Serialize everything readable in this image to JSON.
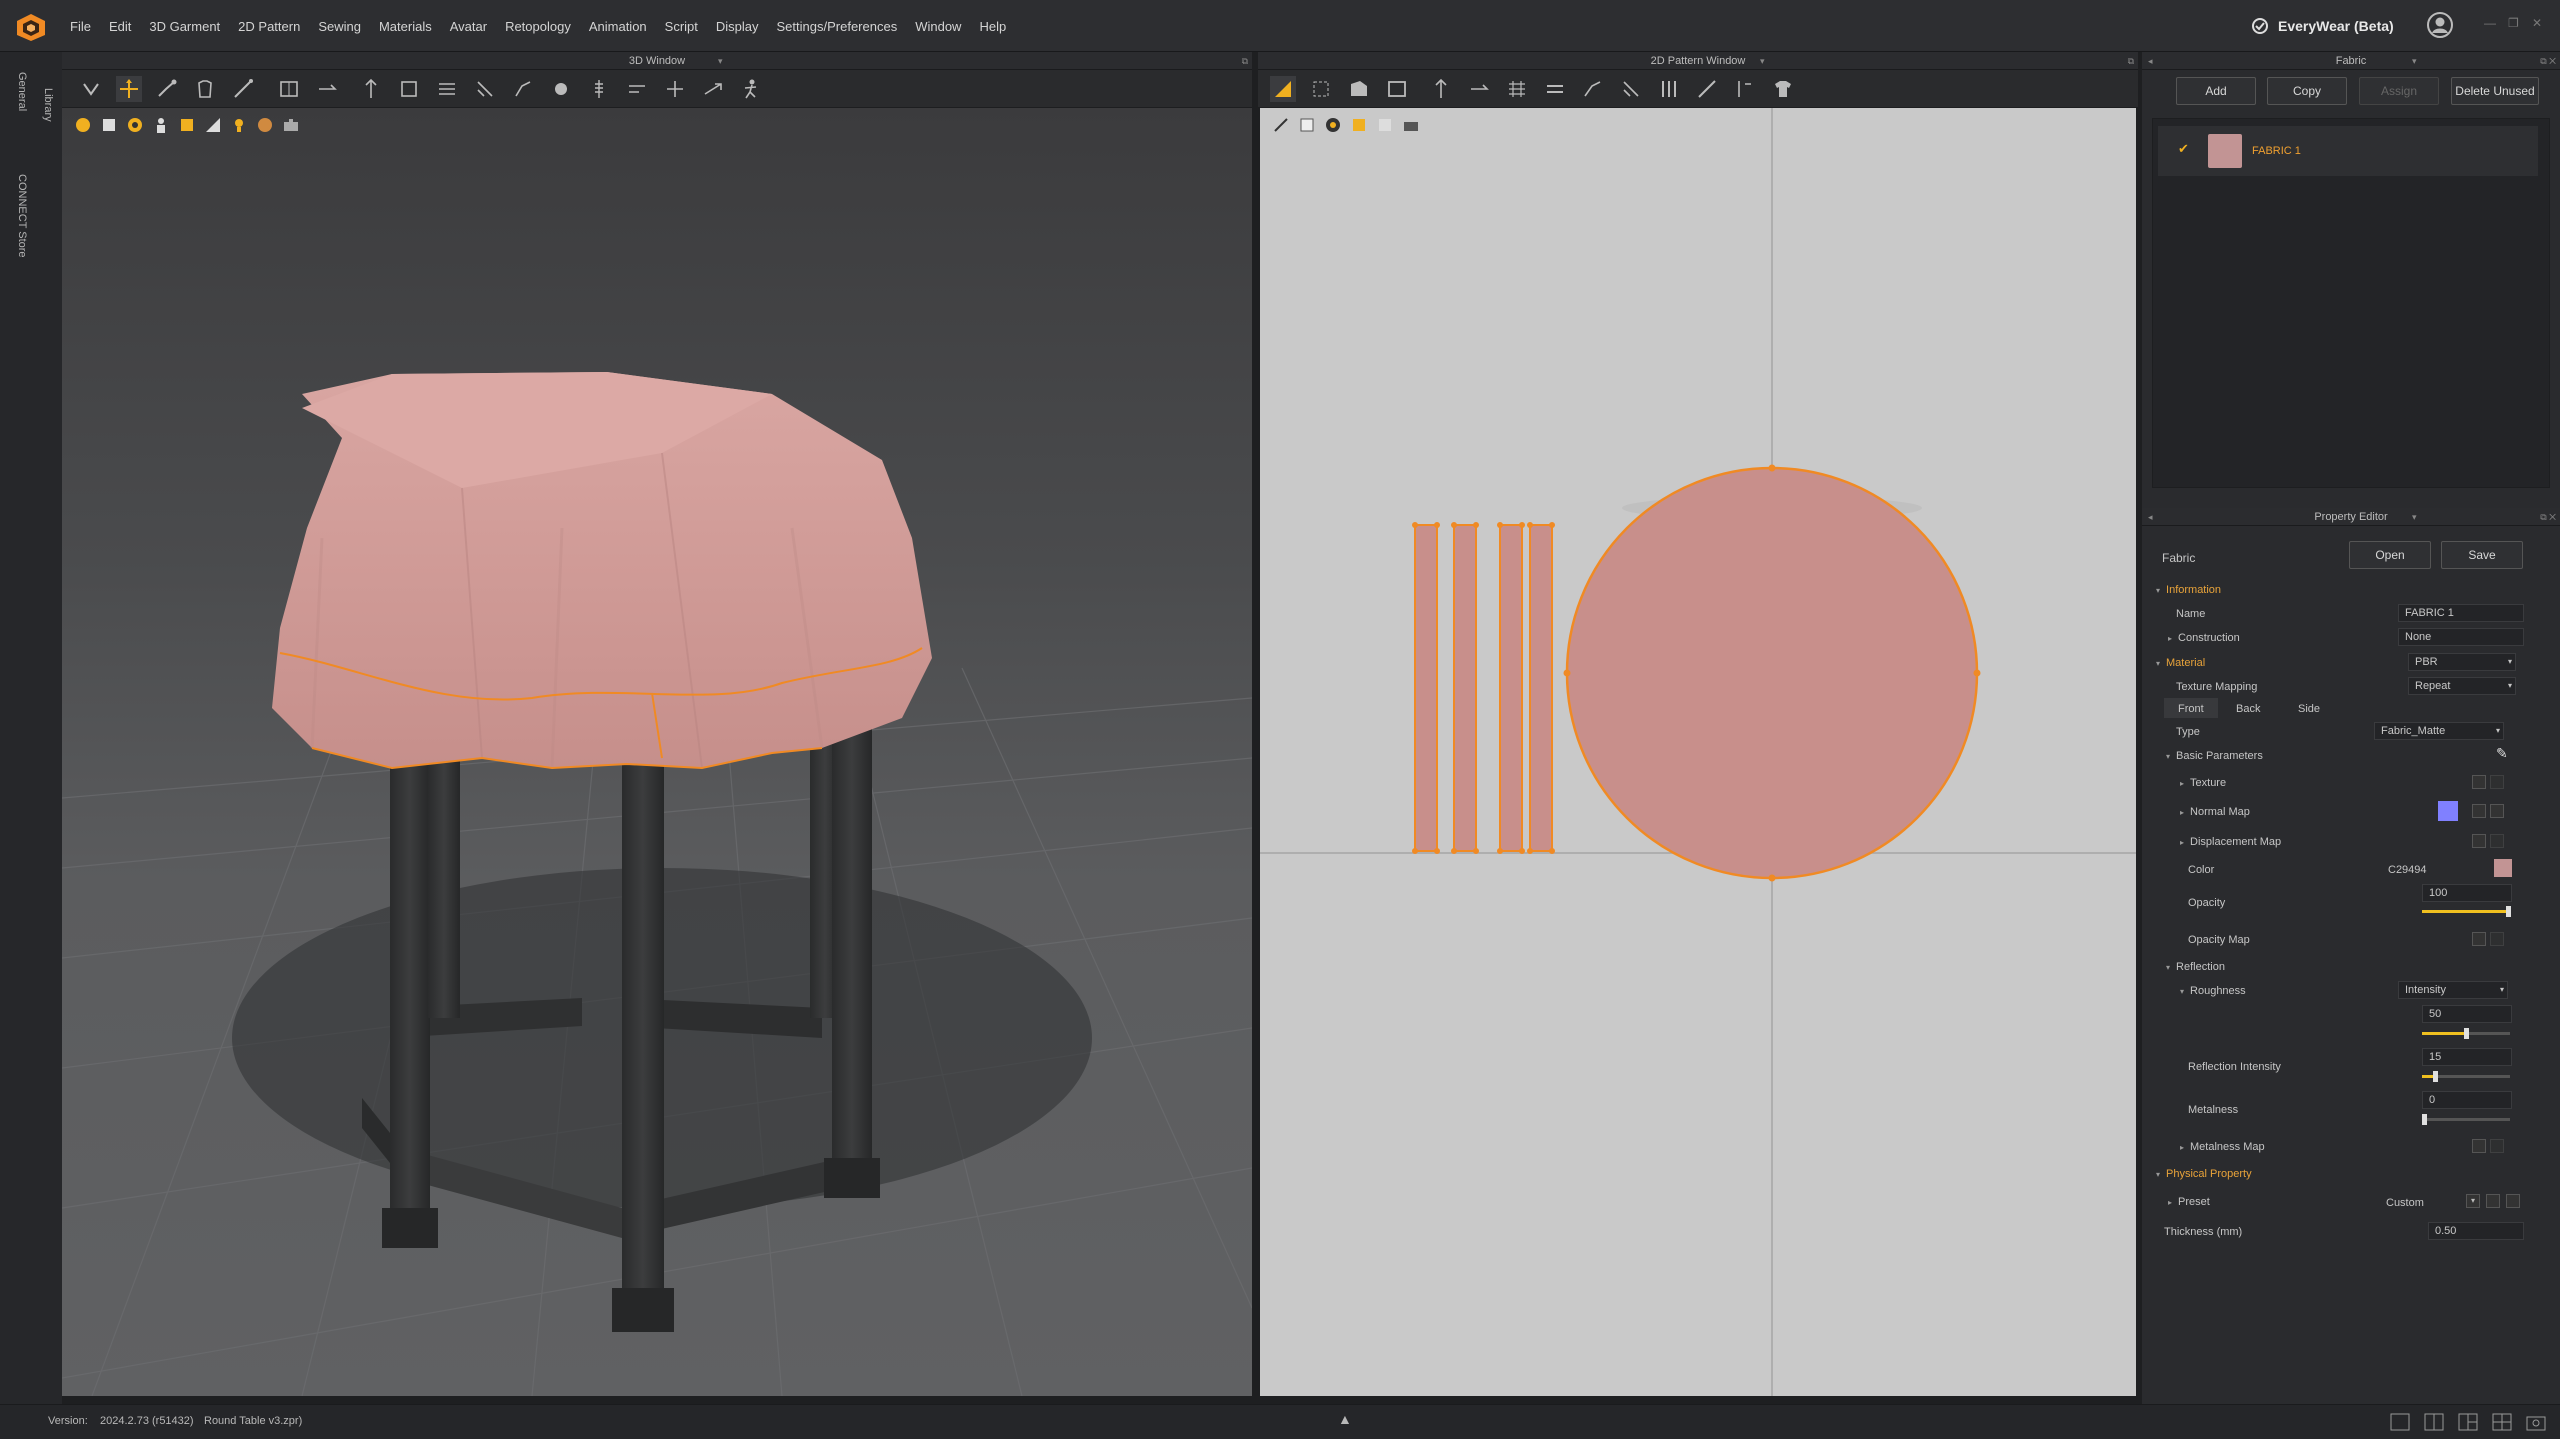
{
  "app": {
    "menu": [
      "File",
      "Edit",
      "3D Garment",
      "2D Pattern",
      "Sewing",
      "Materials",
      "Avatar",
      "Retopology",
      "Animation",
      "Script",
      "Display",
      "Settings/Preferences",
      "Window",
      "Help"
    ],
    "brand": "EveryWear (Beta)",
    "accent_color": "#f08a24"
  },
  "sidebar": {
    "tabs": [
      "General",
      "Library",
      "CONNECT Store"
    ]
  },
  "panels": {
    "window3d_title": "3D Window",
    "window2d_title": "2D Pattern Window",
    "fabric_title": "Fabric",
    "property_title": "Property Editor"
  },
  "fabric_panel": {
    "add": "Add",
    "copy": "Copy",
    "assign": "Assign",
    "delete_unused": "Delete Unused",
    "items": [
      {
        "name": "FABRIC 1",
        "swatch": "#c29494",
        "checked": true
      }
    ]
  },
  "property_editor": {
    "header": "Fabric",
    "open": "Open",
    "save": "Save",
    "information": "Information",
    "name_label": "Name",
    "name_value": "FABRIC 1",
    "construction_label": "Construction",
    "construction_value": "None",
    "material": "Material",
    "material_value": "PBR",
    "texture_mapping_label": "Texture Mapping",
    "texture_mapping_value": "Repeat",
    "sides": [
      "Front",
      "Back",
      "Side"
    ],
    "type_label": "Type",
    "type_value": "Fabric_Matte",
    "basic_parameters": "Basic Parameters",
    "texture": "Texture",
    "normal_map": "Normal Map",
    "displacement_map": "Displacement Map",
    "color_label": "Color",
    "color_value": "C29494",
    "color_hex": "#c29494",
    "normal_color": "#8080ff",
    "opacity_label": "Opacity",
    "opacity_value": "100",
    "opacity_map": "Opacity Map",
    "reflection": "Reflection",
    "roughness_label": "Roughness",
    "roughness_mode": "Intensity",
    "roughness_value": "50",
    "reflection_intensity_label": "Reflection Intensity",
    "reflection_intensity_value": "15",
    "metalness_label": "Metalness",
    "metalness_value": "0",
    "metalness_map": "Metalness Map",
    "physical_property": "Physical Property",
    "preset_label": "Preset",
    "preset_value": "Custom",
    "thickness_label": "Thickness (mm)",
    "thickness_value": "0.50"
  },
  "status": {
    "version_label": "Version:",
    "version_value": "2024.2.73 (r51432)",
    "file": "Round Table v3.zpr)"
  }
}
